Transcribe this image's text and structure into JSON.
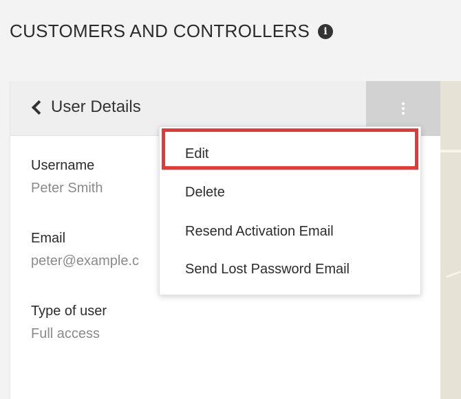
{
  "page": {
    "title": "CUSTOMERS AND CONTROLLERS",
    "info_icon": "info-circle-icon",
    "info_glyph": "i"
  },
  "panel": {
    "back_label": "User Details",
    "back_icon": "chevron-left-icon",
    "menu_icon": "vertical-dots-icon"
  },
  "fields": [
    {
      "label": "Username",
      "value": "Peter Smith"
    },
    {
      "label": "Email",
      "value": "peter@example.c"
    },
    {
      "label": "Type of user",
      "value": "Full access"
    }
  ],
  "dropdown": {
    "items": [
      {
        "label": "Edit",
        "highlighted": true
      },
      {
        "label": "Delete"
      },
      {
        "label": "Resend Activation Email"
      },
      {
        "label": "Send Lost Password Email"
      }
    ],
    "highlight_color": "#e53935"
  },
  "colors": {
    "panel_header_bg": "#efefef",
    "menu_button_bg": "#d2d2d2",
    "label_text": "#2b2b2b",
    "value_text": "#8a8a8a"
  }
}
